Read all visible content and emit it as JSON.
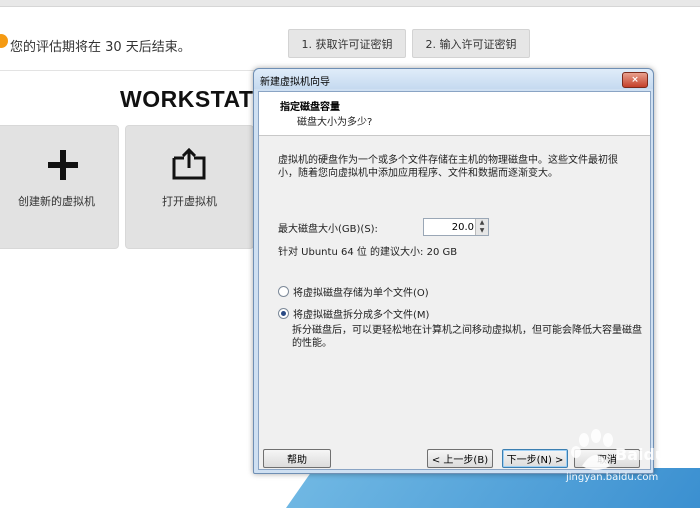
{
  "background": {
    "banner_text": "您的评估期将在 30 天后结束。",
    "license_buttons": [
      "1. 获取许可证密钥",
      "2. 输入许可证密钥"
    ],
    "brand": "WORKSTAT",
    "tiles": [
      {
        "label": "创建新的虚拟机",
        "icon": "plus-icon"
      },
      {
        "label": "打开虚拟机",
        "icon": "open-folder-icon"
      }
    ]
  },
  "dialog": {
    "title": "新建虚拟机向导",
    "close_label": "×",
    "header_title": "指定磁盘容量",
    "header_subtitle": "磁盘大小为多少?",
    "description": "虚拟机的硬盘作为一个或多个文件存储在主机的物理磁盘中。这些文件最初很小，随着您向虚拟机中添加应用程序、文件和数据而逐渐变大。",
    "max_disk_label": "最大磁盘大小(GB)(S):",
    "max_disk_value": "20.0",
    "recommendation": "针对 Ubuntu 64 位 的建议大小: 20 GB",
    "options": [
      {
        "label": "将虚拟磁盘存储为单个文件(O)",
        "checked": false
      },
      {
        "label": "将虚拟磁盘拆分成多个文件(M)",
        "checked": true
      }
    ],
    "split_note": "拆分磁盘后，可以更轻松地在计算机之间移动虚拟机，但可能会降低大容量磁盘的性能。",
    "buttons": {
      "help": "帮助",
      "back": "< 上一步(B)",
      "next": "下一步(N) >",
      "cancel": "取消"
    }
  },
  "watermark": {
    "text": "Baidu经验",
    "url": "jingyan.baidu.com"
  }
}
